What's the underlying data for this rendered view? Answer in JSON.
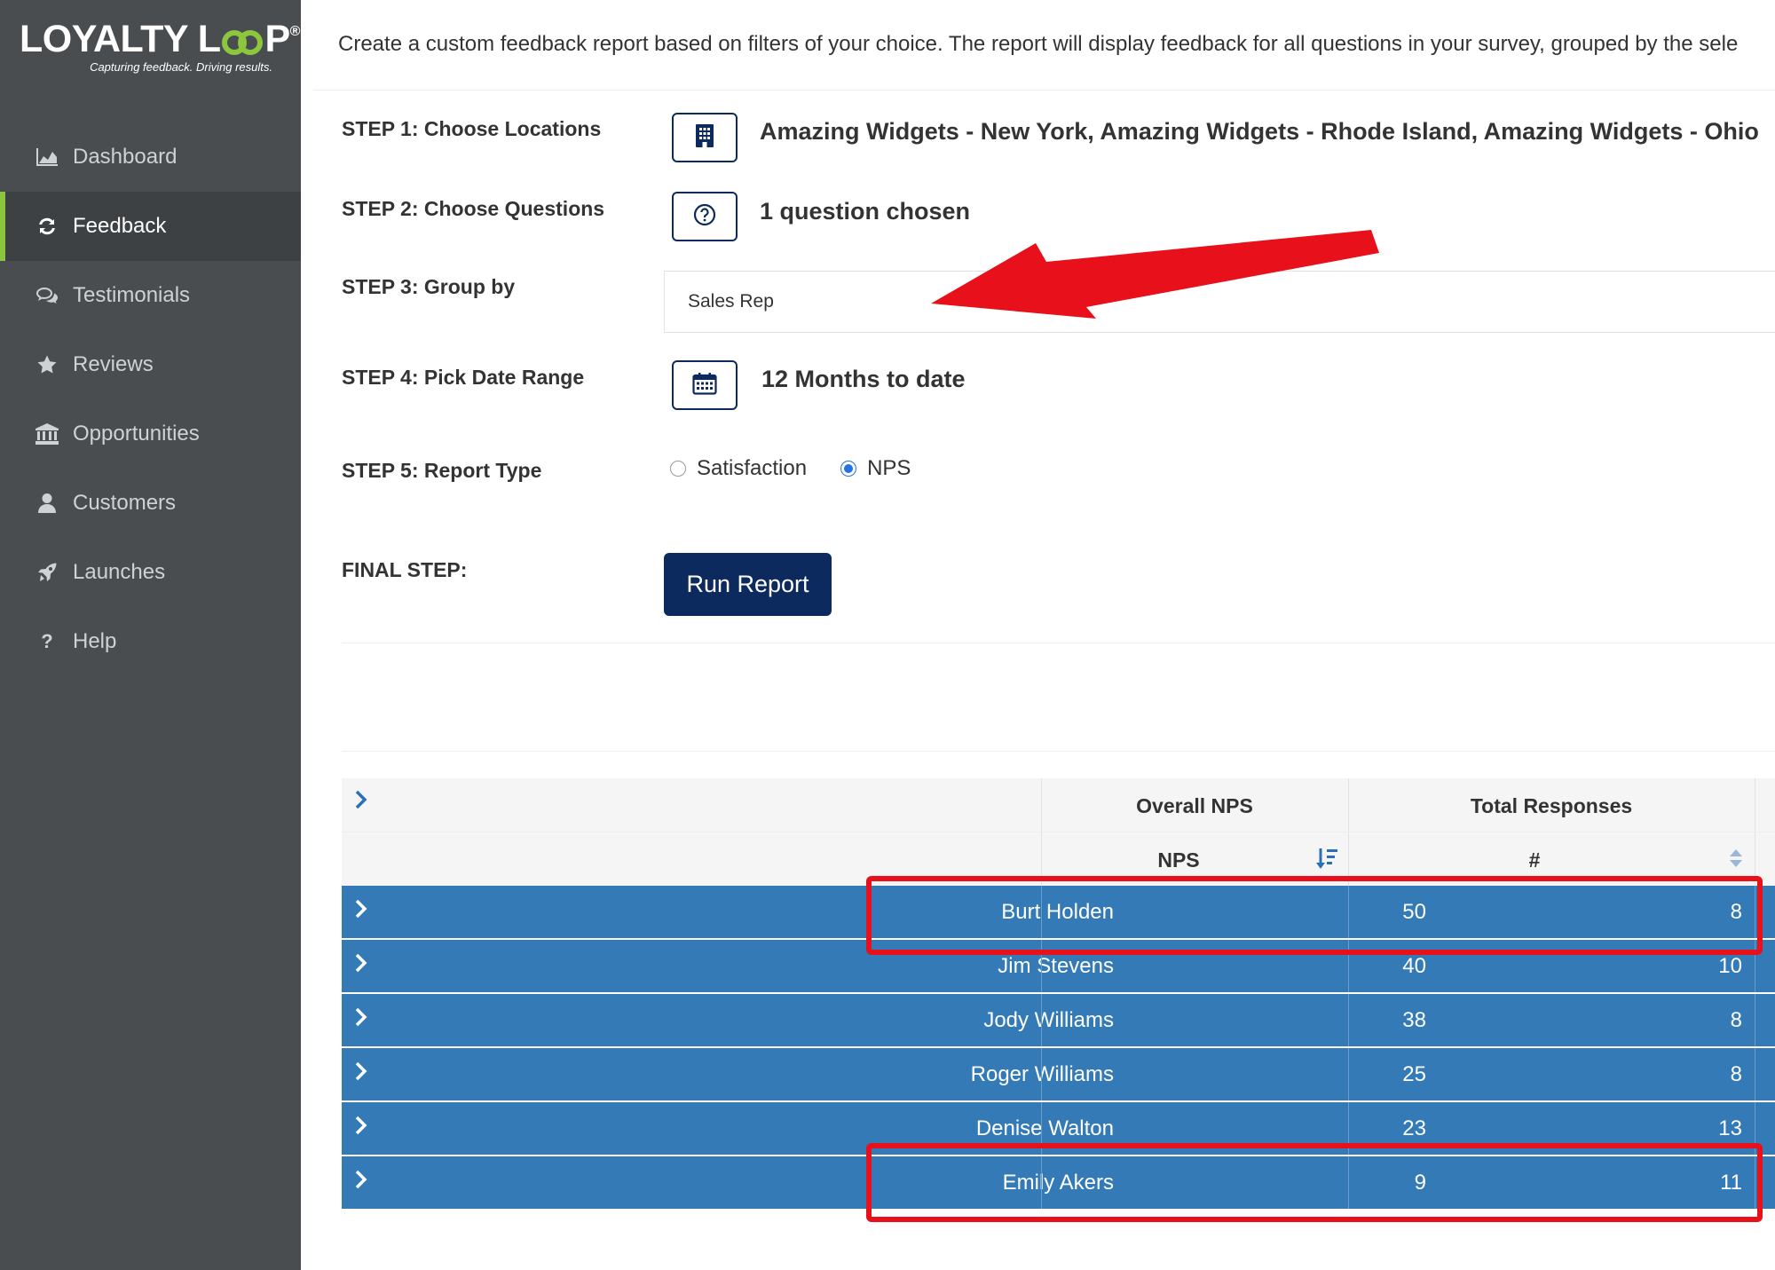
{
  "brand": {
    "name_part1": "LOYALTY L",
    "name_part2": "P",
    "registered": "®",
    "tagline": "Capturing feedback. Driving results.",
    "accent": "#8cc63f"
  },
  "sidebar": {
    "items": [
      {
        "label": "Dashboard",
        "icon": "area-chart-icon"
      },
      {
        "label": "Feedback",
        "icon": "refresh-icon",
        "active": true
      },
      {
        "label": "Testimonials",
        "icon": "comments-icon"
      },
      {
        "label": "Reviews",
        "icon": "star-icon"
      },
      {
        "label": "Opportunities",
        "icon": "bank-icon"
      },
      {
        "label": "Customers",
        "icon": "user-icon"
      },
      {
        "label": "Launches",
        "icon": "rocket-icon"
      },
      {
        "label": "Help",
        "icon": "question-icon"
      }
    ]
  },
  "intro": "Create a custom feedback report based on filters of your choice. The report will display feedback for all questions in your survey, grouped by the sele",
  "steps": {
    "step1_label": "STEP 1: Choose Locations",
    "step1_value": "Amazing Widgets - New York, Amazing Widgets - Rhode Island, Amazing Widgets - Ohio",
    "step2_label": "STEP 2: Choose Questions",
    "step2_value": "1 question chosen",
    "step3_label": "STEP 3: Group by",
    "step3_value": "Sales Rep",
    "step4_label": "STEP 4: Pick Date Range",
    "step4_value": "12 Months to date",
    "step5_label": "STEP 5: Report Type",
    "report_types": [
      "Satisfaction",
      "NPS"
    ],
    "report_type_selected": "NPS",
    "final_label": "FINAL STEP:",
    "run_button": "Run Report"
  },
  "table": {
    "group_headers": [
      "Overall NPS",
      "Total Responses"
    ],
    "sub_headers": [
      "NPS",
      "#"
    ],
    "rows": [
      {
        "name": "Burt Holden",
        "nps": "50",
        "total": "8"
      },
      {
        "name": "Jim Stevens",
        "nps": "40",
        "total": "10"
      },
      {
        "name": "Jody Williams",
        "nps": "38",
        "total": "8"
      },
      {
        "name": "Roger Williams",
        "nps": "25",
        "total": "8"
      },
      {
        "name": "Denise Walton",
        "nps": "23",
        "total": "13"
      },
      {
        "name": "Emily Akers",
        "nps": "9",
        "total": "11"
      }
    ],
    "row_color": "#337ab7"
  },
  "annotation_color": "#e8101a"
}
